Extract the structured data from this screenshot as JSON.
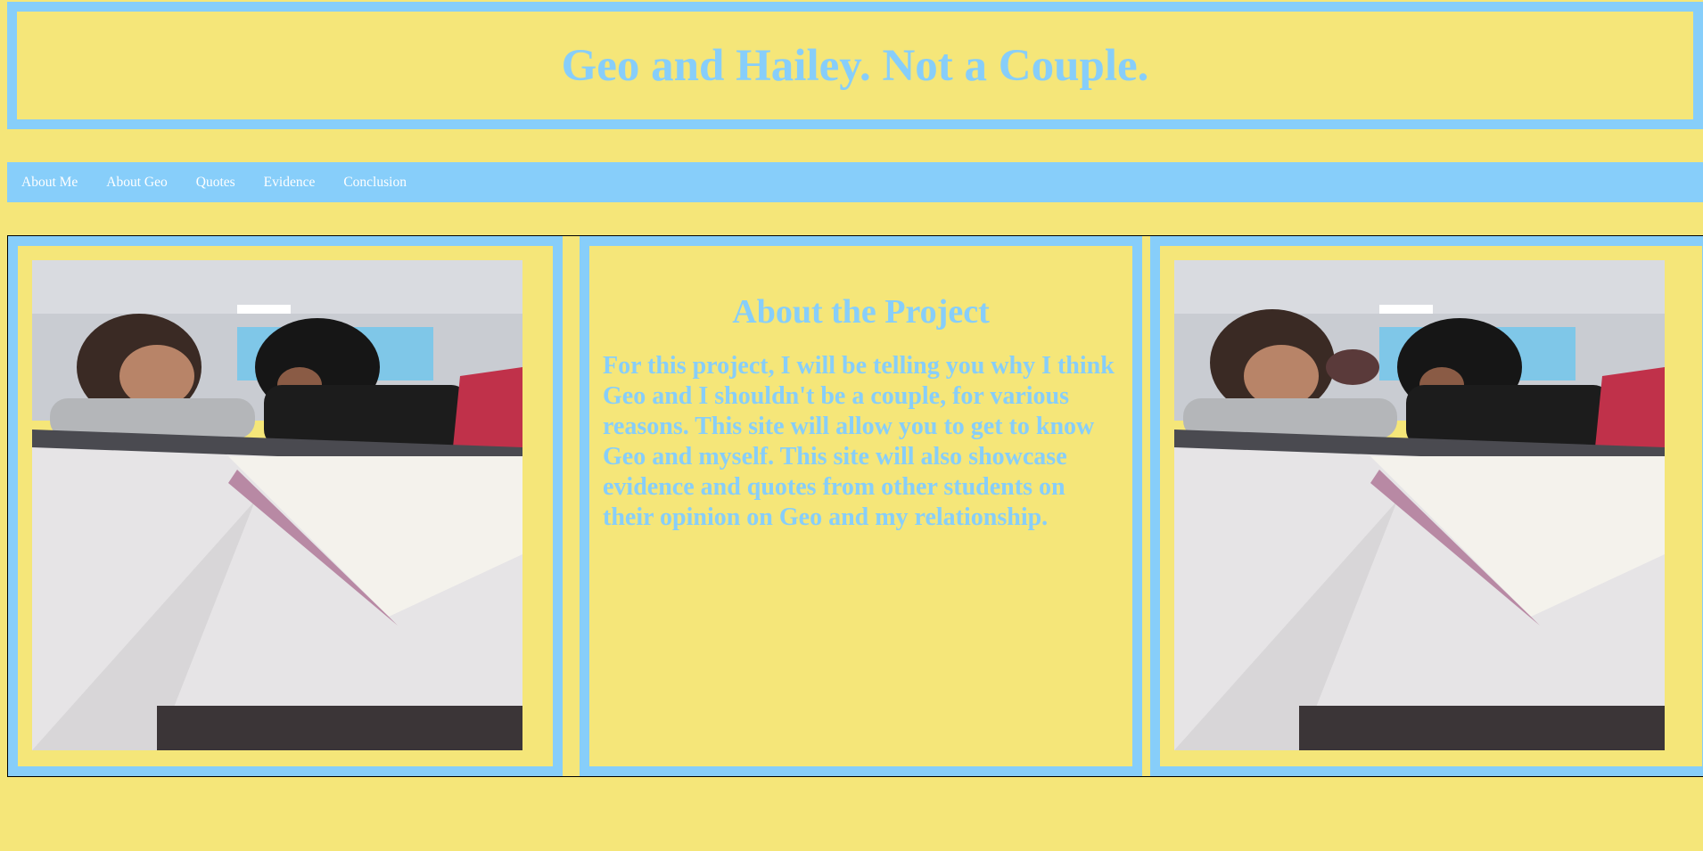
{
  "header": {
    "title": "Geo and Hailey. Not a Couple."
  },
  "nav": {
    "items": [
      {
        "label": "About Me"
      },
      {
        "label": "About Geo"
      },
      {
        "label": "Quotes"
      },
      {
        "label": "Evidence"
      },
      {
        "label": "Conclusion"
      }
    ]
  },
  "about": {
    "heading": "About the Project",
    "body": "For this project, I will be telling you why I think Geo and I shouldn't be a couple, for various reasons. This site will allow you to get to know Geo and myself. This site will also showcase evidence and quotes from other students on their opinion on Geo and my relationship."
  },
  "colors": {
    "background": "#f5e679",
    "accent": "#87cefa",
    "nav_text": "#ffffff"
  }
}
